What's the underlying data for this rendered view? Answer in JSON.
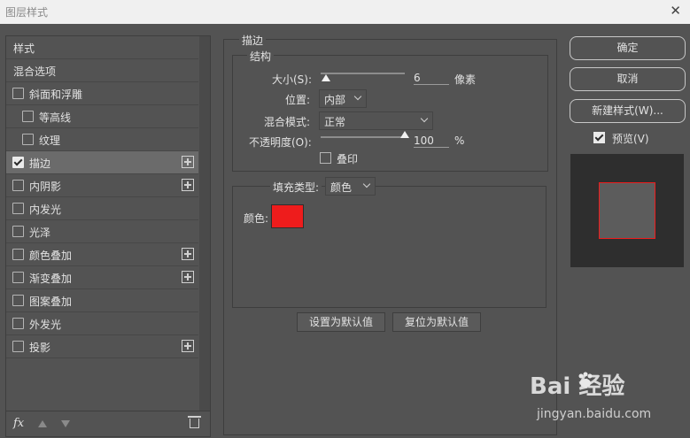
{
  "window": {
    "title": "图层样式",
    "close_glyph": "✕"
  },
  "sidebar": {
    "header": "样式",
    "blend_options": "混合选项",
    "items": [
      {
        "label": "斜面和浮雕",
        "checked": false,
        "plus": false,
        "indent": false
      },
      {
        "label": "等高线",
        "checked": false,
        "plus": false,
        "indent": true
      },
      {
        "label": "纹理",
        "checked": false,
        "plus": false,
        "indent": true
      },
      {
        "label": "描边",
        "checked": true,
        "plus": true,
        "indent": false,
        "active": true
      },
      {
        "label": "内阴影",
        "checked": false,
        "plus": true,
        "indent": false
      },
      {
        "label": "内发光",
        "checked": false,
        "plus": false,
        "indent": false
      },
      {
        "label": "光泽",
        "checked": false,
        "plus": false,
        "indent": false
      },
      {
        "label": "颜色叠加",
        "checked": false,
        "plus": true,
        "indent": false
      },
      {
        "label": "渐变叠加",
        "checked": false,
        "plus": true,
        "indent": false
      },
      {
        "label": "图案叠加",
        "checked": false,
        "plus": false,
        "indent": false
      },
      {
        "label": "外发光",
        "checked": false,
        "plus": false,
        "indent": false
      },
      {
        "label": "投影",
        "checked": false,
        "plus": true,
        "indent": false
      }
    ],
    "footer": {
      "fx_label": "fx"
    }
  },
  "stroke": {
    "section_title": "描边",
    "structure_title": "结构",
    "size_label": "大小(S):",
    "size_value": "6",
    "size_unit": "像素",
    "size_slider_fraction": 0.06,
    "position_label": "位置:",
    "position_value": "内部",
    "blend_label": "混合模式:",
    "blend_value": "正常",
    "opacity_label": "不透明度(O):",
    "opacity_value": "100",
    "opacity_unit": "%",
    "opacity_slider_fraction": 1.0,
    "overprint_label": "叠印",
    "fill_type_label": "填充类型:",
    "fill_type_value": "颜色",
    "color_label": "颜色:",
    "color_value": "#ee1c1c",
    "set_default": "设置为默认值",
    "reset_default": "复位为默认值"
  },
  "actions": {
    "ok": "确定",
    "cancel": "取消",
    "new_style": "新建样式(W)...",
    "preview_label": "预览(V)",
    "preview_checked": true
  },
  "watermark": {
    "main": "Bai 经验",
    "sub": "jingyan.baidu.com"
  }
}
